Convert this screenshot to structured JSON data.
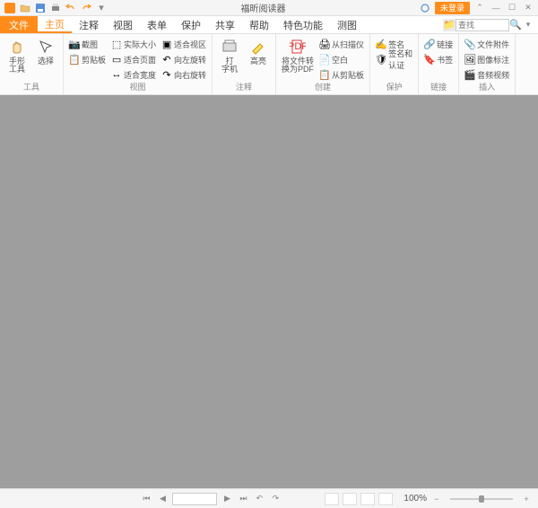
{
  "titlebar": {
    "app_title": "福昕阅读器"
  },
  "title_right": {
    "login": "未登录"
  },
  "tabs": {
    "file": "文件",
    "items": [
      "主页",
      "注释",
      "视图",
      "表单",
      "保护",
      "共享",
      "帮助",
      "特色功能",
      "测图"
    ],
    "active_index": 0
  },
  "search": {
    "placeholder": "查找"
  },
  "ribbon": {
    "tools": {
      "label": "工具",
      "hand": "手形\n工具",
      "select": "选择"
    },
    "view": {
      "label": "视图",
      "snapshot": "截图",
      "clipboard": "剪贴板",
      "actual": "实际大小",
      "fitpage": "适合页面",
      "fitwidth": "适合宽度",
      "fitvisible": "适合视区",
      "rotl": "向左旋转",
      "rotr": "向右旋转"
    },
    "comment": {
      "label": "注释",
      "typewriter": "打\n字机",
      "highlight": "高亮"
    },
    "create": {
      "label": "创建",
      "convert": "将文件转\n换为PDF",
      "scan": "从扫描仪",
      "blank": "空白",
      "clip": "从剪贴板"
    },
    "protect": {
      "label": "保护",
      "sign": "签名",
      "secure": "签名和\n认证"
    },
    "links": {
      "label": "链接",
      "link": "链接",
      "bookmark": "书签"
    },
    "insert": {
      "label": "插入",
      "attach": "文件附件",
      "imgann": "图像标注",
      "av": "音频视频"
    }
  },
  "statusbar": {
    "page_value": "",
    "zoom_text": "100%"
  }
}
